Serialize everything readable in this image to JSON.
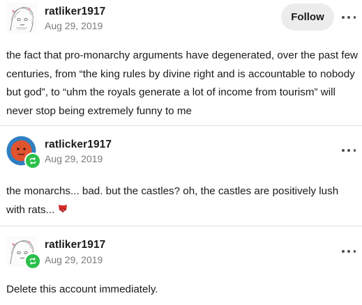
{
  "posts": [
    {
      "username": "ratliker1917",
      "date": "Aug 29, 2019",
      "follow_label": "Follow",
      "avatar_icon": "sketch-avatar",
      "body": "the fact that pro-monarchy arguments have degenerated, over the past few centuries, from “the king rules by divine right and is accountable to nobody but god”, to “uhm the royals generate a lot of income from tourism” will never stop being extremely funny to me"
    },
    {
      "username": "ratlicker1917",
      "date": "Aug 29, 2019",
      "avatar_icon": "face-avatar",
      "reblog_icon": "reblog-icon",
      "body": "the monarchs... bad. but the castles? oh, the castles are positively lush with rats...",
      "emoji_icon": "tongue-out-emoji"
    },
    {
      "username": "ratliker1917",
      "date": "Aug 29, 2019",
      "avatar_icon": "sketch-avatar",
      "reblog_icon": "reblog-icon",
      "body": "Delete this account immediately."
    }
  ],
  "colors": {
    "follow_bg": "#ececec",
    "reblog_badge": "#2bbf4a",
    "avatar_face": "#e0532f",
    "avatar_ring": "#2f7fc1",
    "divider": "#e0e0e0",
    "timestamp": "#7a7a7a"
  }
}
